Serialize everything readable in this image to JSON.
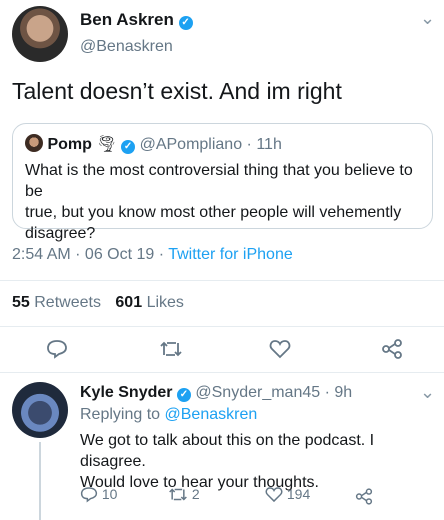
{
  "main_tweet": {
    "author_name": "Ben Askren",
    "author_handle": "@Benaskren",
    "text": "Talent doesn’t exist.  And im right",
    "timestamp": "2:54 AM · 06 Oct 19 · ",
    "client": "Twitter for iPhone",
    "retweets_count": "55",
    "retweets_label": "Retweets",
    "likes_count": "601",
    "likes_label": "Likes"
  },
  "quoted_tweet": {
    "author_name": "Pomp",
    "emoji": "🌪",
    "author_handle": "@APompliano",
    "time": "11h",
    "text_lines": [
      "What is the most controversial thing that you believe to be",
      "true, but you know most other people will vehemently",
      "disagree?"
    ]
  },
  "reply": {
    "author_name": "Kyle Snyder",
    "author_handle": "@Snyder_man45",
    "time": "9h",
    "replying_prefix": "Replying to ",
    "replying_to": "@Benaskren",
    "text_lines": [
      "We got to talk about this on the podcast. I disagree.",
      "Would love to hear your thoughts."
    ],
    "reply_count": "10",
    "retweet_count": "2",
    "like_count": "194"
  },
  "colors": {
    "accent": "#1da1f2",
    "muted": "#657786",
    "border": "#e6ecf0"
  }
}
